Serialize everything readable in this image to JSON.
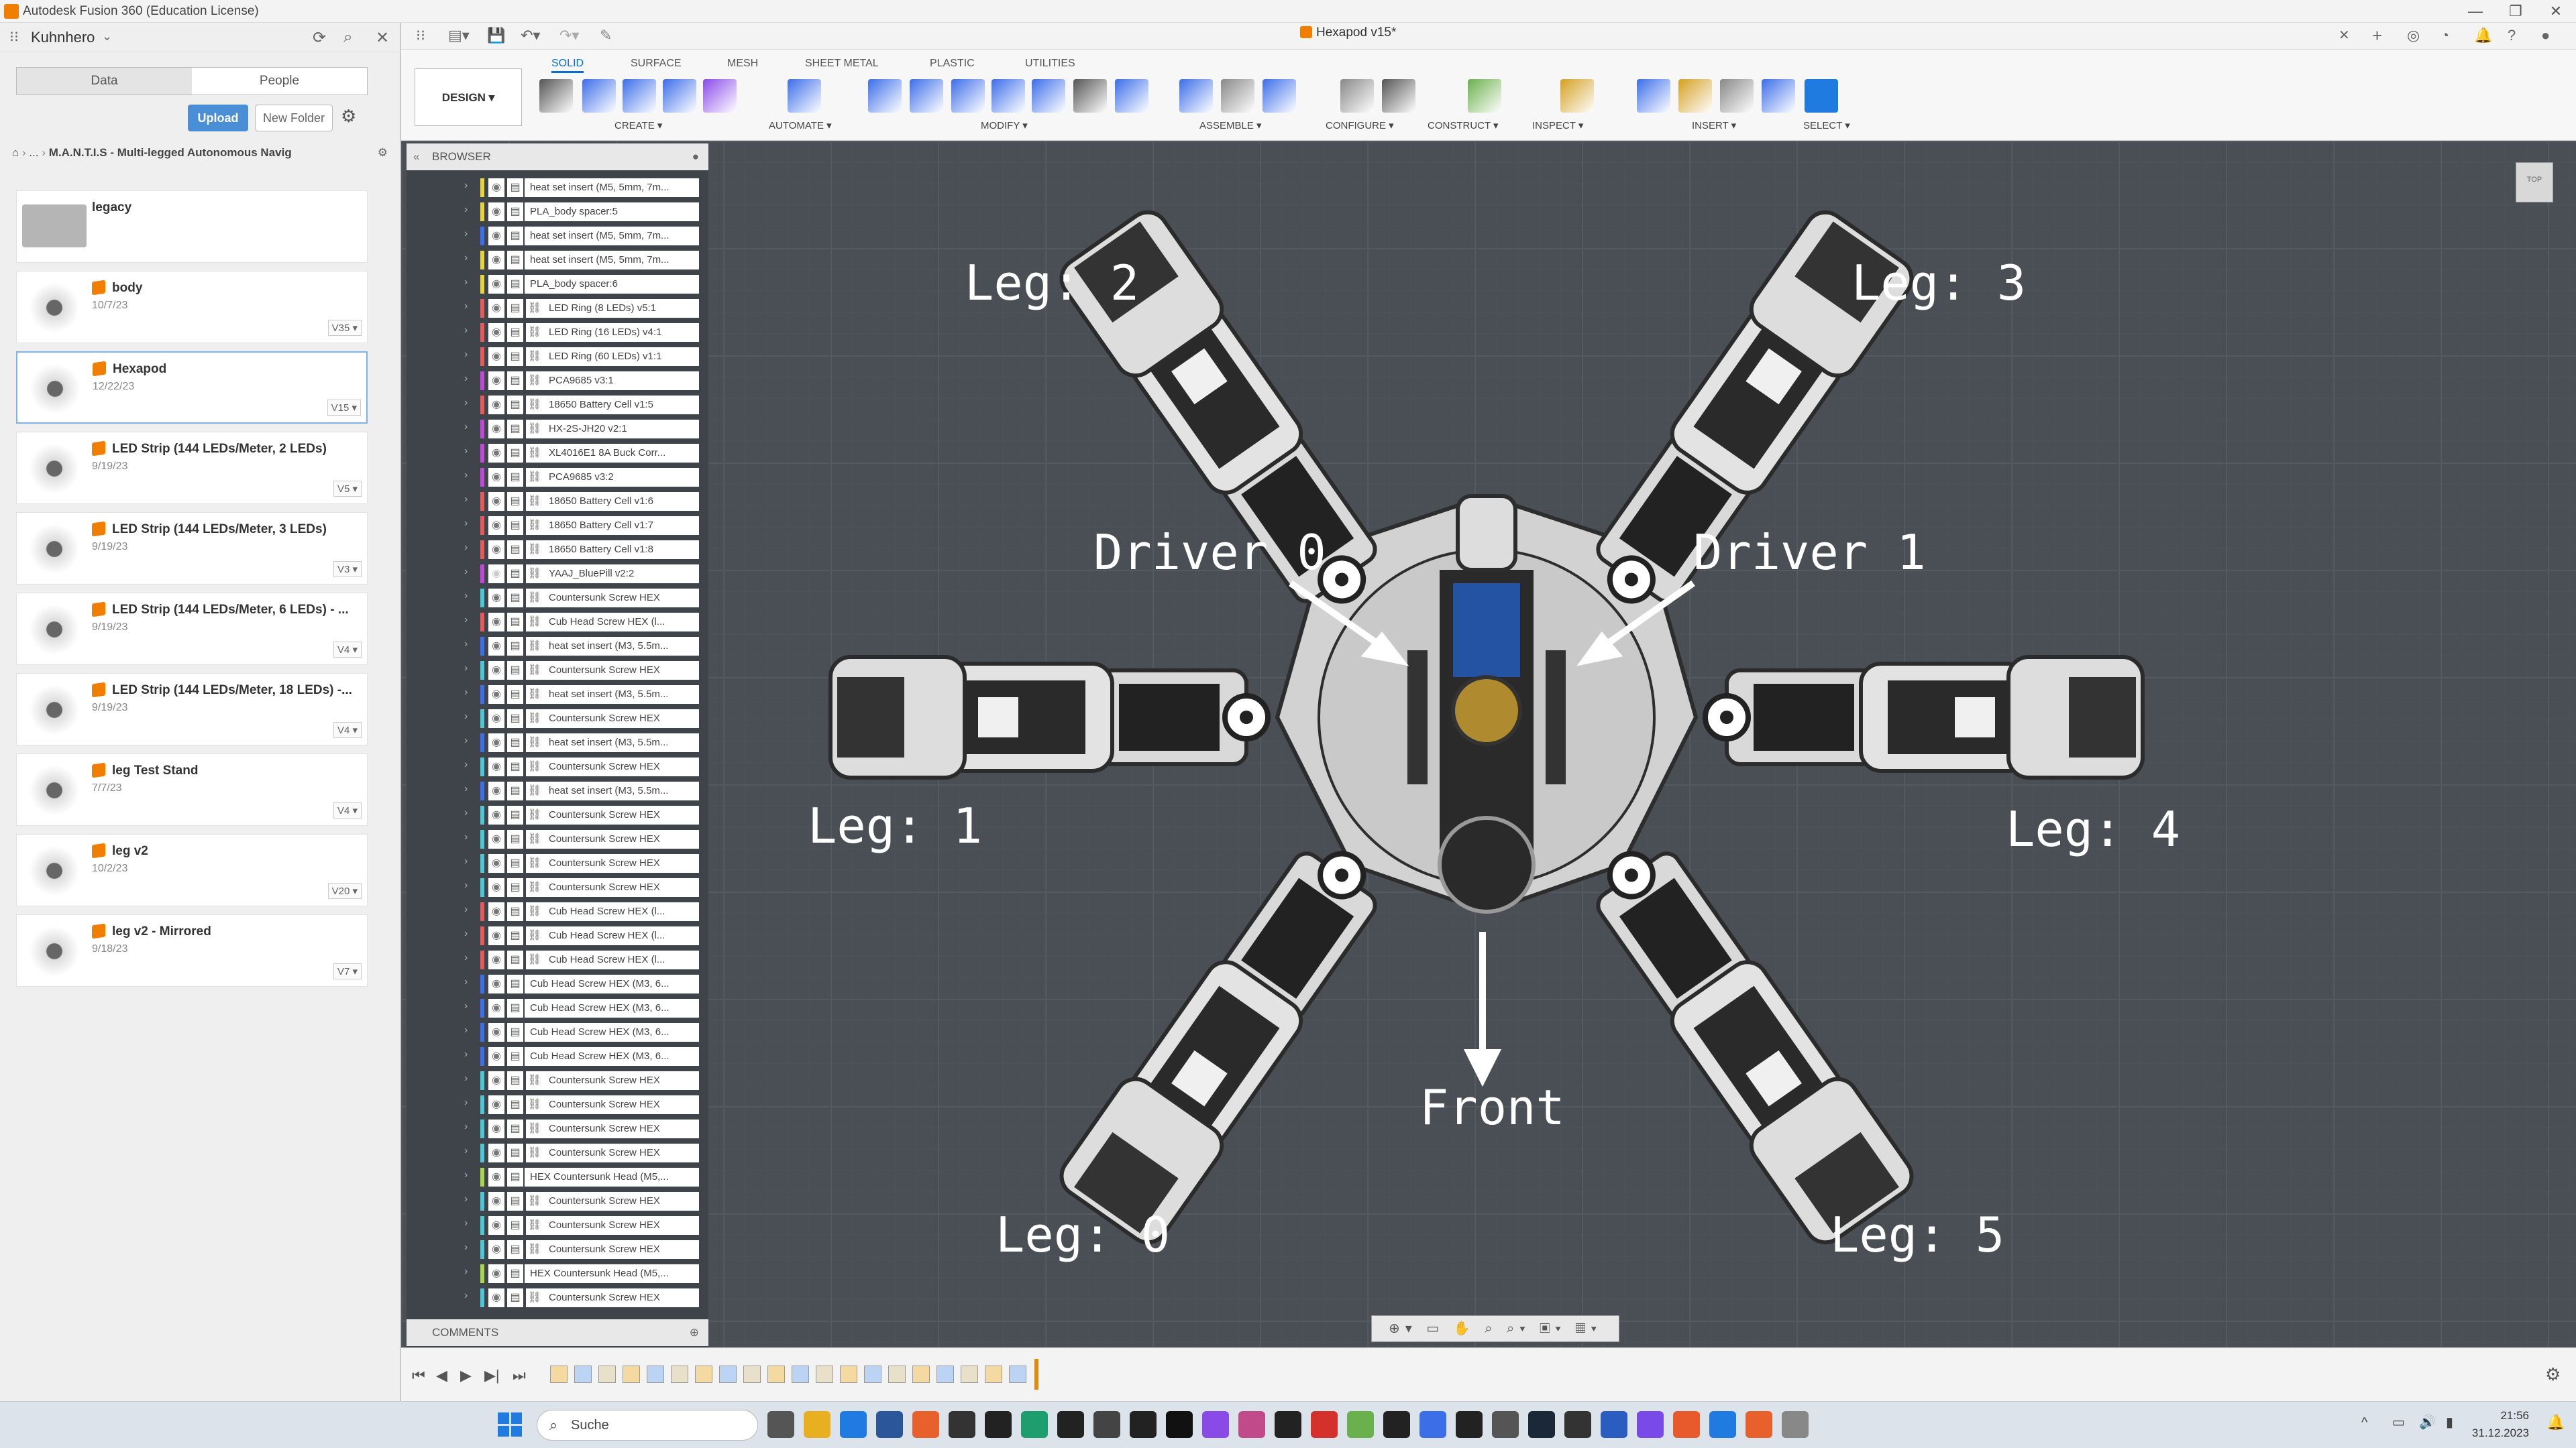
{
  "app": {
    "title": "Autodesk Fusion 360 (Education License)"
  },
  "panel": {
    "team": "Kuhnhero",
    "tab_data": "Data",
    "tab_people": "People",
    "upload": "Upload",
    "new_folder": "New Folder",
    "breadcrumb_dots": "...",
    "breadcrumb": "M.A.N.T.I.S - Multi-legged Autonomous Navig"
  },
  "files": [
    {
      "name": "legacy",
      "date": "",
      "version": "",
      "folder": true
    },
    {
      "name": "body",
      "date": "10/7/23",
      "version": "V35"
    },
    {
      "name": "Hexapod",
      "date": "12/22/23",
      "version": "V15"
    },
    {
      "name": "LED Strip (144 LEDs/Meter, 2 LEDs)",
      "date": "9/19/23",
      "version": "V5"
    },
    {
      "name": "LED Strip (144 LEDs/Meter, 3 LEDs)",
      "date": "9/19/23",
      "version": "V3"
    },
    {
      "name": "LED Strip (144 LEDs/Meter, 6 LEDs) - ...",
      "date": "9/19/23",
      "version": "V4"
    },
    {
      "name": "LED Strip (144 LEDs/Meter, 18 LEDs) -...",
      "date": "9/19/23",
      "version": "V4"
    },
    {
      "name": "leg Test Stand",
      "date": "7/7/23",
      "version": "V4"
    },
    {
      "name": "leg v2",
      "date": "10/2/23",
      "version": "V20"
    },
    {
      "name": "leg v2 - Mirrored",
      "date": "9/18/23",
      "version": "V7"
    }
  ],
  "document": {
    "tab": "Hexapod v15*"
  },
  "toolbar": {
    "design": "DESIGN ▾",
    "tabs": [
      "SOLID",
      "SURFACE",
      "MESH",
      "SHEET METAL",
      "PLASTIC",
      "UTILITIES"
    ],
    "groups": [
      "CREATE ▾",
      "AUTOMATE ▾",
      "MODIFY ▾",
      "ASSEMBLE ▾",
      "CONFIGURE ▾",
      "CONSTRUCT ▾",
      "INSPECT ▾",
      "INSERT ▾",
      "SELECT ▾"
    ]
  },
  "browser": {
    "header": "BROWSER",
    "comments": "COMMENTS",
    "items": [
      {
        "label": "heat set insert (M5, 5mm, 7m...",
        "color": "#e8d43c",
        "link": false
      },
      {
        "label": "PLA_body spacer:5",
        "color": "#e8d43c",
        "link": false
      },
      {
        "label": "heat set insert (M5, 5mm, 7m...",
        "color": "#3c6ee8",
        "link": false
      },
      {
        "label": "heat set insert (M5, 5mm, 7m...",
        "color": "#e8d43c",
        "link": false
      },
      {
        "label": "PLA_body spacer:6",
        "color": "#e8d43c",
        "link": false
      },
      {
        "label": "LED Ring (8 LEDs) v5:1",
        "color": "#e85a5a",
        "link": true
      },
      {
        "label": "LED Ring (16 LEDs) v4:1",
        "color": "#e85a5a",
        "link": true
      },
      {
        "label": "LED Ring (60 LEDs) v1:1",
        "color": "#e85a5a",
        "link": true
      },
      {
        "label": "PCA9685 v3:1",
        "color": "#c04ad8",
        "link": true
      },
      {
        "label": "18650 Battery Cell v1:5",
        "color": "#e85a5a",
        "link": true
      },
      {
        "label": "HX-2S-JH20 v2:1",
        "color": "#c04ad8",
        "link": true
      },
      {
        "label": "XL4016E1 8A Buck Corr...",
        "color": "#c04ad8",
        "link": true
      },
      {
        "label": "PCA9685 v3:2",
        "color": "#c04ad8",
        "link": true
      },
      {
        "label": "18650 Battery Cell v1:6",
        "color": "#e85a5a",
        "link": true
      },
      {
        "label": "18650 Battery Cell v1:7",
        "color": "#e85a5a",
        "link": true
      },
      {
        "label": "18650 Battery Cell v1:8",
        "color": "#e85a5a",
        "link": true
      },
      {
        "label": "YAAJ_BluePill v2:2",
        "color": "#c04ad8",
        "link": true,
        "hidden": true
      },
      {
        "label": "Countersunk Screw HEX",
        "color": "#4ac8d8",
        "link": true
      },
      {
        "label": "Cub Head Screw HEX (l...",
        "color": "#e85a5a",
        "link": true
      },
      {
        "label": "heat set insert (M3, 5.5m...",
        "color": "#3c6ee8",
        "link": true
      },
      {
        "label": "Countersunk Screw HEX",
        "color": "#4ac8d8",
        "link": true
      },
      {
        "label": "heat set insert (M3, 5.5m...",
        "color": "#3c6ee8",
        "link": true
      },
      {
        "label": "Countersunk Screw HEX",
        "color": "#4ac8d8",
        "link": true
      },
      {
        "label": "heat set insert (M3, 5.5m...",
        "color": "#3c6ee8",
        "link": true
      },
      {
        "label": "Countersunk Screw HEX",
        "color": "#4ac8d8",
        "link": true
      },
      {
        "label": "heat set insert (M3, 5.5m...",
        "color": "#3c6ee8",
        "link": true
      },
      {
        "label": "Countersunk Screw HEX",
        "color": "#4ac8d8",
        "link": true
      },
      {
        "label": "Countersunk Screw HEX",
        "color": "#4ac8d8",
        "link": true
      },
      {
        "label": "Countersunk Screw HEX",
        "color": "#4ac8d8",
        "link": true
      },
      {
        "label": "Countersunk Screw HEX",
        "color": "#4ac8d8",
        "link": true
      },
      {
        "label": "Cub Head Screw HEX (l...",
        "color": "#e85a5a",
        "link": true
      },
      {
        "label": "Cub Head Screw HEX (l...",
        "color": "#e85a5a",
        "link": true
      },
      {
        "label": "Cub Head Screw HEX (l...",
        "color": "#e85a5a",
        "link": true
      },
      {
        "label": "Cub Head Screw HEX (M3, 6...",
        "color": "#3c6ee8",
        "link": false
      },
      {
        "label": "Cub Head Screw HEX (M3, 6...",
        "color": "#3c6ee8",
        "link": false
      },
      {
        "label": "Cub Head Screw HEX (M3, 6...",
        "color": "#3c6ee8",
        "link": false
      },
      {
        "label": "Cub Head Screw HEX (M3, 6...",
        "color": "#3c6ee8",
        "link": false
      },
      {
        "label": "Countersunk Screw HEX",
        "color": "#4ac8d8",
        "link": true
      },
      {
        "label": "Countersunk Screw HEX",
        "color": "#4ac8d8",
        "link": true
      },
      {
        "label": "Countersunk Screw HEX",
        "color": "#4ac8d8",
        "link": true
      },
      {
        "label": "Countersunk Screw HEX",
        "color": "#4ac8d8",
        "link": true
      },
      {
        "label": "HEX Countersunk Head (M5,...",
        "color": "#a8d84a",
        "link": false
      },
      {
        "label": "Countersunk Screw HEX",
        "color": "#4ac8d8",
        "link": true
      },
      {
        "label": "Countersunk Screw HEX",
        "color": "#4ac8d8",
        "link": true
      },
      {
        "label": "Countersunk Screw HEX",
        "color": "#4ac8d8",
        "link": true
      },
      {
        "label": "HEX Countersunk Head (M5,...",
        "color": "#a8d84a",
        "link": false
      },
      {
        "label": "Countersunk Screw HEX",
        "color": "#4ac8d8",
        "link": true
      }
    ]
  },
  "viewport": {
    "leg0": "Leg: 0",
    "leg1": "Leg: 1",
    "leg2": "Leg: 2",
    "leg3": "Leg: 3",
    "leg4": "Leg: 4",
    "leg5": "Leg: 5",
    "driver0": "Driver 0",
    "driver1": "Driver 1",
    "front": "Front",
    "viewcube": "TOP"
  },
  "taskbar": {
    "search": "Suche",
    "time": "21:56",
    "date": "31.12.2023"
  }
}
